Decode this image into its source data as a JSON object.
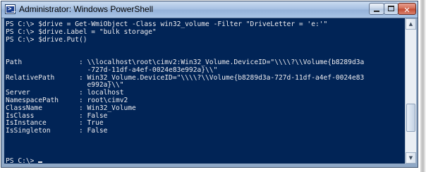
{
  "window": {
    "title": "Administrator: Windows PowerShell",
    "icon": "powershell-icon",
    "icon_glyph": ">_",
    "minimize_glyph": "",
    "maximize_glyph": "",
    "close_glyph": "✕"
  },
  "console": {
    "background": "#012456",
    "foreground": "#eeedf0",
    "lines": [
      "PS C:\\> $drive = Get-WmiObject -Class win32_volume -Filter \"DriveLetter = 'e:'\"",
      "PS C:\\> $drive.Label = \"bulk storage\"",
      "PS C:\\> $drive.Put()",
      "",
      "",
      "Path              : \\\\localhost\\root\\cimv2:Win32_Volume.DeviceID=\"\\\\\\\\?\\\\Volume{b8289d3a",
      "                    -727d-11df-a4ef-0024e83e992a}\\\\\"",
      "RelativePath      : Win32_Volume.DeviceID=\"\\\\\\\\?\\\\Volume{b8289d3a-727d-11df-a4ef-0024e83",
      "                    e992a}\\\\\"",
      "Server            : localhost",
      "NamespacePath     : root\\cimv2",
      "ClassName         : Win32_Volume",
      "IsClass           : False",
      "IsInstance        : True",
      "IsSingleton       : False",
      "",
      "",
      "",
      "PS C:\\> "
    ]
  },
  "scrollbar": {
    "up_glyph": "▲",
    "down_glyph": "▼",
    "position_fraction": 0.78
  }
}
